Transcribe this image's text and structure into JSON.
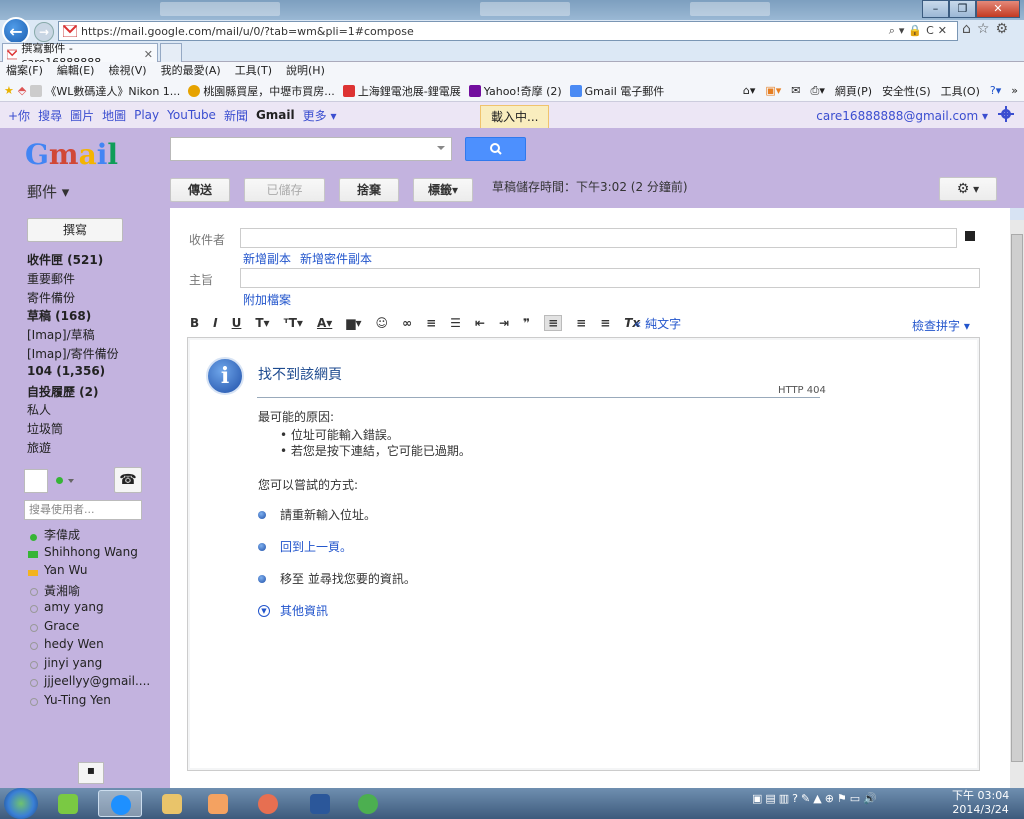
{
  "browser": {
    "url": "https://mail.google.com/mail/u/0/?tab=wm&pli=1#compose",
    "tab_label": "撰寫郵件 - care16888888...",
    "menu": [
      "檔案(F)",
      "編輯(E)",
      "檢視(V)",
      "我的最愛(A)",
      "工具(T)",
      "說明(H)"
    ],
    "favorites": [
      "《WL數碼達人》Nikon 1...",
      "桃園縣買屋，中壢市買房...",
      "上海鋰電池展-鋰電展",
      "Yahoo!奇摩 (2)",
      "Gmail 電子郵件"
    ],
    "tools": [
      "網頁(P)",
      "安全性(S)",
      "工具(O)"
    ]
  },
  "gbar": {
    "links": [
      "+你",
      "搜尋",
      "圖片",
      "地圖",
      "Play",
      "YouTube",
      "新聞"
    ],
    "current": "Gmail",
    "more": "更多",
    "loading": "載入中...",
    "account": "care16888888@gmail.com"
  },
  "header": {
    "logo": "Gmail",
    "mail_menu": "郵件",
    "buttons": {
      "send": "傳送",
      "saved": "已儲存",
      "discard": "捨棄",
      "labels": "標籤"
    },
    "saved_time": "草稿儲存時間：下午3:02 (2 分鐘前)"
  },
  "sidebar": {
    "compose": "撰寫",
    "items": [
      {
        "label": "收件匣 (521)",
        "bold": true
      },
      {
        "label": "重要郵件",
        "bold": false
      },
      {
        "label": "寄件備份",
        "bold": false
      },
      {
        "label": "草稿 (168)",
        "bold": true
      },
      {
        "label": "[Imap]/草稿",
        "bold": false
      },
      {
        "label": "[Imap]/寄件備份",
        "bold": false
      },
      {
        "label": "104 (1,356)",
        "bold": true
      },
      {
        "label": "自投履歷 (2)",
        "bold": true
      },
      {
        "label": "私人",
        "bold": false
      },
      {
        "label": "垃圾筒",
        "bold": false
      },
      {
        "label": "旅遊",
        "bold": false
      }
    ],
    "people_search_placeholder": "搜尋使用者...",
    "contacts": [
      {
        "name": "李偉成",
        "status": "green"
      },
      {
        "name": "Shihhong Wang",
        "status": "video"
      },
      {
        "name": "Yan Wu",
        "status": "away"
      },
      {
        "name": "黃湘喻",
        "status": "off"
      },
      {
        "name": "amy yang",
        "status": "off"
      },
      {
        "name": "Grace",
        "status": "off"
      },
      {
        "name": "hedy Wen",
        "status": "off"
      },
      {
        "name": "jinyi yang",
        "status": "off"
      },
      {
        "name": "jjjeellyy@gmail....",
        "status": "off"
      },
      {
        "name": "Yu-Ting Yen",
        "status": "off"
      }
    ]
  },
  "compose": {
    "to_label": "收件者",
    "cc": "新增副本",
    "bcc": "新增密件副本",
    "subject_label": "主旨",
    "attach": "附加檔案",
    "plain_text": "« 純文字",
    "spell_check": "檢查拼字"
  },
  "error": {
    "title": "找不到該網頁",
    "code": "HTTP 404",
    "reasons_heading": "最可能的原因:",
    "reasons": [
      "位址可能輸入錯誤。",
      "若您是按下連結，它可能已過期。"
    ],
    "try_heading": "您可以嘗試的方式:",
    "options": [
      {
        "text": "請重新輸入位址。",
        "link": false
      },
      {
        "text": "回到上一頁。",
        "link": true
      },
      {
        "text": "移至  並尋找您要的資訊。",
        "link": false
      }
    ],
    "more_info": "其他資訊"
  },
  "taskbar": {
    "time": "下午 03:04",
    "date": "2014/3/24"
  },
  "colors": {
    "gmail_purple": "#c3b3df",
    "link_blue": "#2255cc",
    "search_button": "#4d90fe"
  }
}
